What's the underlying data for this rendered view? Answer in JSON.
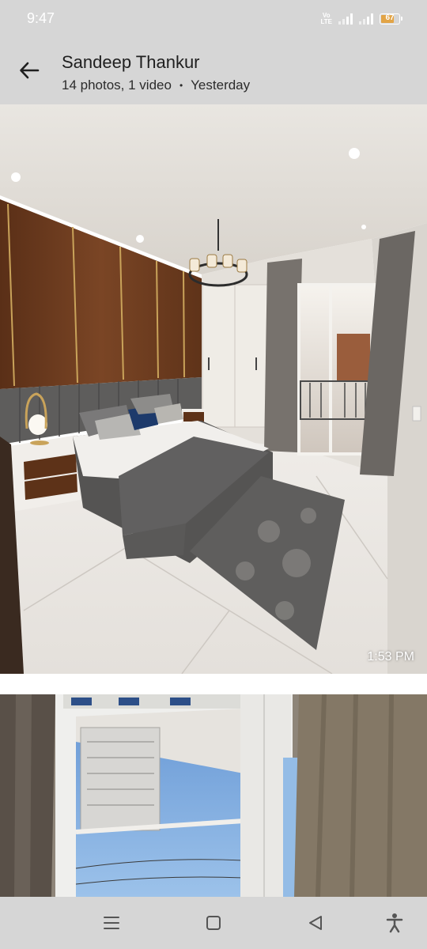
{
  "status_bar": {
    "time": "9:47",
    "network_label": "VoLTE",
    "battery_level": "67",
    "battery_fill": 0.67,
    "battery_color": "#e2a446"
  },
  "header": {
    "back_icon": "arrow-left-icon",
    "title": "Sandeep Thankur",
    "subtitle_counts": "14 photos, 1 video",
    "subtitle_separator": "•",
    "subtitle_date": "Yesterday"
  },
  "media": [
    {
      "kind": "photo",
      "description": "bedroom interior",
      "timestamp": "1:53 PM"
    },
    {
      "kind": "photo",
      "description": "balcony door view",
      "timestamp": ""
    }
  ],
  "nav_bar": {
    "items": [
      {
        "icon": "menu-icon"
      },
      {
        "icon": "home-square-icon"
      },
      {
        "icon": "back-triangle-icon"
      },
      {
        "icon": "accessibility-icon"
      }
    ]
  },
  "colors": {
    "bars": "#d6d6d6",
    "text_primary": "#1f1f1f",
    "nav_icon": "#555555"
  }
}
